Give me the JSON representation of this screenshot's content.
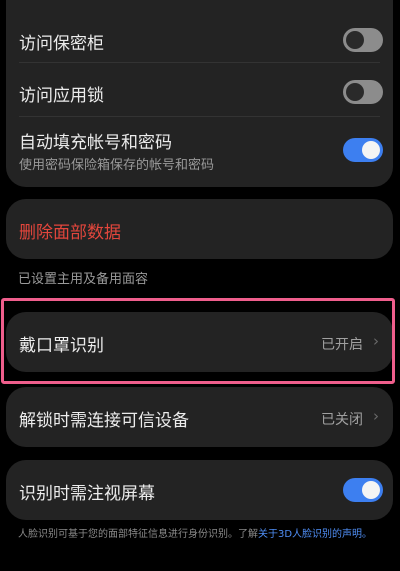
{
  "privacy_card": {
    "items": [
      {
        "label": "访问保密柜",
        "toggle": false
      },
      {
        "label": "访问应用锁",
        "toggle": false
      },
      {
        "label": "自动填充帐号和密码",
        "sublabel": "使用密码保险箱保存的帐号和密码",
        "toggle": true
      }
    ]
  },
  "delete_face_data": {
    "label": "删除面部数据"
  },
  "face_section": {
    "caption": "已设置主用及备用面容"
  },
  "mask_recognition": {
    "label": "戴口罩识别",
    "value": "已开启"
  },
  "trusted_device": {
    "label": "解锁时需连接可信设备",
    "value": "已关闭"
  },
  "gaze_detection": {
    "label": "识别时需注视屏幕",
    "toggle": true
  },
  "footer": {
    "text": "人脸识别可基于您的面部特征信息进行身份识别。了解",
    "link": "关于3D人脸识别的声明。"
  },
  "colors": {
    "accent": "#3d7ff0",
    "danger": "#e2463c",
    "highlight": "#ef5e8c",
    "background": "#000000",
    "card": "#232323"
  },
  "icons": {
    "chevron": "chevron-right-icon"
  }
}
